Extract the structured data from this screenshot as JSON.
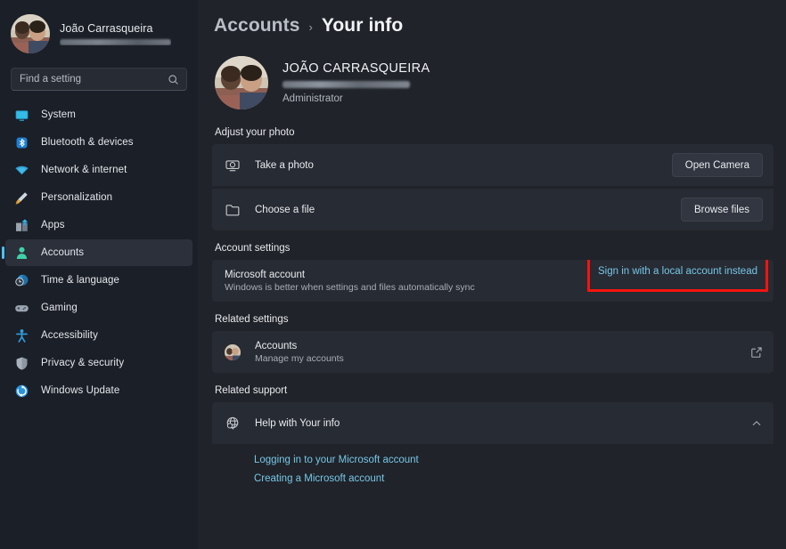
{
  "colors": {
    "accent": "#4cc2ff",
    "link": "#76c7e8",
    "highlight_box": "#f5130f",
    "sidebar_bg": "#1b1f27",
    "main_bg": "#202329",
    "card_bg": "#272b33"
  },
  "sidebar": {
    "profile": {
      "name": "João Carrasqueira",
      "email_redacted": ""
    },
    "search": {
      "placeholder": "Find a setting",
      "value": "",
      "icon": "search-icon"
    },
    "items": [
      {
        "label": "System",
        "icon": "display-icon",
        "selected": false
      },
      {
        "label": "Bluetooth & devices",
        "icon": "bluetooth-icon",
        "selected": false
      },
      {
        "label": "Network & internet",
        "icon": "wifi-icon",
        "selected": false
      },
      {
        "label": "Personalization",
        "icon": "paintbrush-icon",
        "selected": false
      },
      {
        "label": "Apps",
        "icon": "apps-icon",
        "selected": false
      },
      {
        "label": "Accounts",
        "icon": "person-icon",
        "selected": true
      },
      {
        "label": "Time & language",
        "icon": "clock-globe-icon",
        "selected": false
      },
      {
        "label": "Gaming",
        "icon": "gamepad-icon",
        "selected": false
      },
      {
        "label": "Accessibility",
        "icon": "accessibility-icon",
        "selected": false
      },
      {
        "label": "Privacy & security",
        "icon": "shield-icon",
        "selected": false
      },
      {
        "label": "Windows Update",
        "icon": "update-icon",
        "selected": false
      }
    ]
  },
  "header": {
    "breadcrumb_parent": "Accounts",
    "breadcrumb_separator": "›",
    "breadcrumb_current": "Your info"
  },
  "hero": {
    "name": "JOÃO CARRASQUEIRA",
    "email_redacted": "",
    "role": "Administrator"
  },
  "adjust_photo": {
    "section_title": "Adjust your photo",
    "rows": [
      {
        "title": "Take a photo",
        "icon": "camera-icon",
        "button": "Open Camera"
      },
      {
        "title": "Choose a file",
        "icon": "folder-icon",
        "button": "Browse files"
      }
    ]
  },
  "account_settings": {
    "section_title": "Account settings",
    "row": {
      "title": "Microsoft account",
      "subtitle": "Windows is better when settings and files automatically sync",
      "link": "Sign in with a local account instead"
    }
  },
  "related_settings": {
    "section_title": "Related settings",
    "row": {
      "title": "Accounts",
      "subtitle": "Manage my accounts",
      "icon": "avatar-icon",
      "trailing_icon": "external-link-icon"
    }
  },
  "related_support": {
    "section_title": "Related support",
    "row": {
      "title": "Help with Your info",
      "icon": "globe-help-icon",
      "trailing_icon": "chevron-up-icon"
    },
    "links": [
      "Logging in to your Microsoft account",
      "Creating a Microsoft account"
    ]
  }
}
